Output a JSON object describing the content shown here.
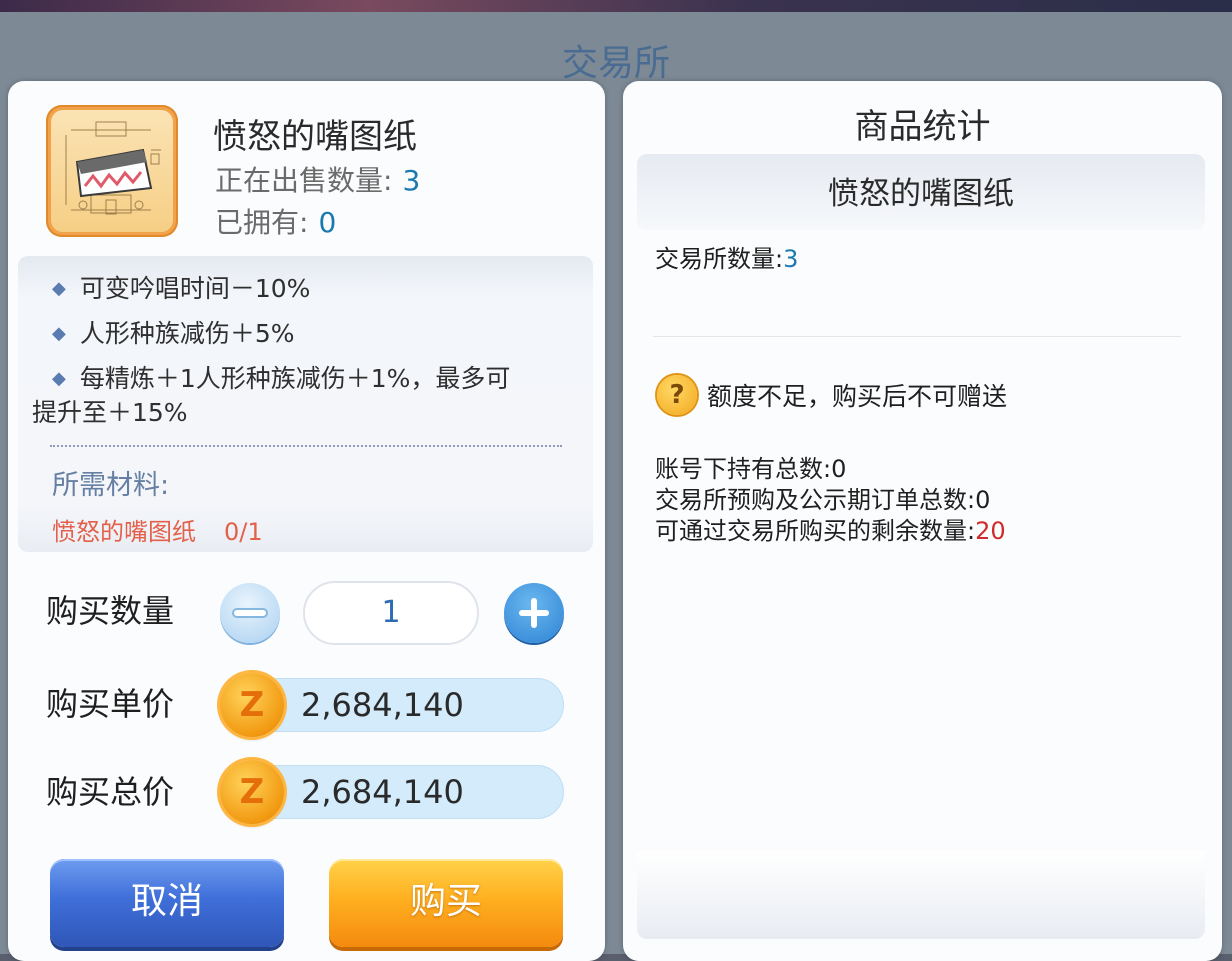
{
  "background": {
    "title": "交易所"
  },
  "item": {
    "name": "愤怒的嘴图纸",
    "on_sale_label": "正在出售数量:",
    "on_sale_value": "3",
    "owned_label": "已拥有:",
    "owned_value": "0",
    "icon": "blueprint-icon"
  },
  "effects": [
    "可变吟唱时间－10%",
    "人形种族减伤＋5%",
    "每精炼＋1人形种族减伤＋1%，最多可",
    "提升至＋15%"
  ],
  "materials": {
    "label": "所需材料:",
    "items": [
      {
        "name": "愤怒的嘴图纸",
        "count": "0/1"
      }
    ]
  },
  "purchase": {
    "qty_label": "购买数量",
    "qty_value": "1",
    "unit_label": "购买单价",
    "unit_price": "2,684,140",
    "total_label": "购买总价",
    "total_price": "2,684,140",
    "currency_icon": "zeny-coin-icon",
    "currency_glyph": "Z",
    "cancel_label": "取消",
    "buy_label": "购买"
  },
  "stats": {
    "title": "商品统计",
    "item_name": "愤怒的嘴图纸",
    "exchange_qty_label": "交易所数量:",
    "exchange_qty_value": "3",
    "warning": "额度不足，购买后不可赠送",
    "held_total_label": "账号下持有总数:",
    "held_total_value": "0",
    "preorder_label": "交易所预购及公示期订单总数:",
    "preorder_value": "0",
    "remaining_label": "可通过交易所购买的剩余数量:",
    "remaining_value": "20"
  },
  "colors": {
    "accent_blue": "#1a7ab0",
    "warning_red": "#d12a2a",
    "material_red": "#e4604a",
    "cancel_blue": "#3f6fd9",
    "buy_orange": "#ffb020"
  }
}
